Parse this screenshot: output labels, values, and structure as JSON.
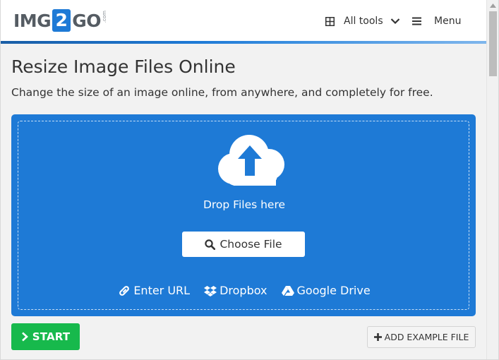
{
  "header": {
    "logo": {
      "part1": "IMG",
      "part2": "2",
      "part3": "GO",
      "suffix": ".com"
    },
    "all_tools_label": "All tools",
    "menu_label": "Menu"
  },
  "main": {
    "title": "Resize Image Files Online",
    "subtitle": "Change the size of an image online, from anywhere, and completely for free.",
    "dropzone": {
      "drop_text": "Drop Files here",
      "choose_label": "Choose File",
      "sources": {
        "url": "Enter URL",
        "dropbox": "Dropbox",
        "gdrive": "Google Drive"
      }
    },
    "start_label": "START",
    "example_label": "ADD EXAMPLE FILE"
  },
  "colors": {
    "accent": "#1e7ad6",
    "start": "#17b94c",
    "background": "#f2f2f2"
  },
  "icons": [
    "grid-icon",
    "chevron-down-icon",
    "hamburger-icon",
    "cloud-upload-icon",
    "search-icon",
    "link-icon",
    "dropbox-icon",
    "google-drive-icon",
    "chevron-right-icon",
    "plus-icon"
  ]
}
